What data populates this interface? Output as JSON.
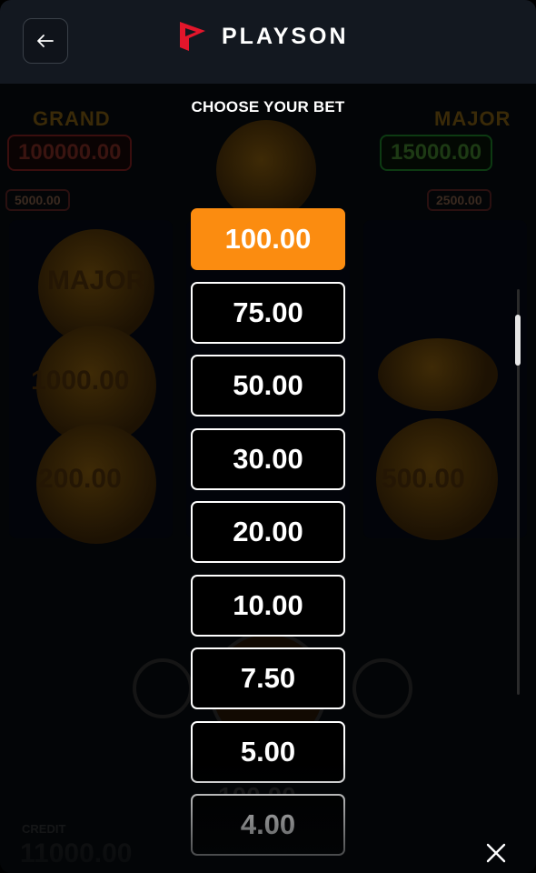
{
  "header": {
    "brand": "PLAYSON",
    "back_icon": "arrow-left-icon"
  },
  "title": "CHOOSE YOUR BET",
  "bets": [
    {
      "label": "100.00",
      "selected": true
    },
    {
      "label": "75.00",
      "selected": false
    },
    {
      "label": "50.00",
      "selected": false
    },
    {
      "label": "30.00",
      "selected": false
    },
    {
      "label": "20.00",
      "selected": false
    },
    {
      "label": "10.00",
      "selected": false
    },
    {
      "label": "7.50",
      "selected": false
    },
    {
      "label": "5.00",
      "selected": false
    },
    {
      "label": "4.00",
      "selected": false
    }
  ],
  "background": {
    "grand_label": "GRAND",
    "grand_value": "100000.00",
    "major_label": "MAJOR",
    "major_value": "15000.00",
    "minor_value": "5000.00",
    "mini_value": "2500.00",
    "coin_1": "MAJOR",
    "coin_2": "1000.00",
    "coin_3": "200.00",
    "coin_4": "500.00",
    "total_bet": "100.00",
    "balance_label": "CREDIT",
    "balance": "11000.00"
  },
  "colors": {
    "accent": "#fb8c10",
    "brand_red": "#e3162b",
    "header_bg": "#131820"
  },
  "close_icon": "close-icon"
}
